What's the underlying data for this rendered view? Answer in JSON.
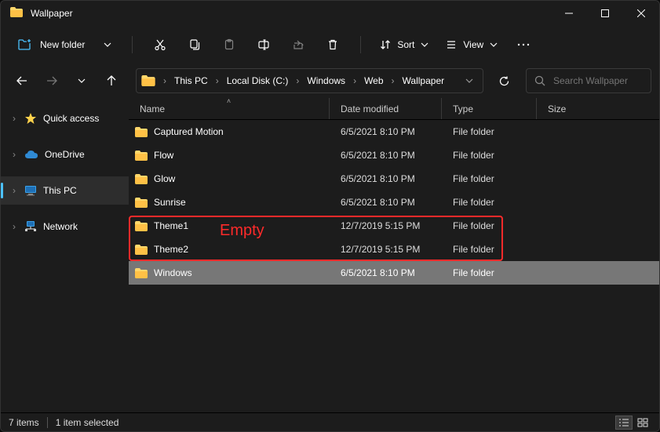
{
  "title": "Wallpaper",
  "toolbar": {
    "new_label": "New folder",
    "sort_label": "Sort",
    "view_label": "View"
  },
  "breadcrumb": [
    "This PC",
    "Local Disk (C:)",
    "Windows",
    "Web",
    "Wallpaper"
  ],
  "search": {
    "placeholder": "Search Wallpaper"
  },
  "sidebar": {
    "items": [
      {
        "label": "Quick access",
        "icon": "star"
      },
      {
        "label": "OneDrive",
        "icon": "cloud"
      },
      {
        "label": "This PC",
        "icon": "pc",
        "active": true
      },
      {
        "label": "Network",
        "icon": "network"
      }
    ]
  },
  "columns": {
    "name": "Name",
    "date": "Date modified",
    "type": "Type",
    "size": "Size"
  },
  "rows": [
    {
      "name": "Captured Motion",
      "date": "6/5/2021 8:10 PM",
      "type": "File folder"
    },
    {
      "name": "Flow",
      "date": "6/5/2021 8:10 PM",
      "type": "File folder"
    },
    {
      "name": "Glow",
      "date": "6/5/2021 8:10 PM",
      "type": "File folder"
    },
    {
      "name": "Sunrise",
      "date": "6/5/2021 8:10 PM",
      "type": "File folder"
    },
    {
      "name": "Theme1",
      "date": "12/7/2019 5:15 PM",
      "type": "File folder"
    },
    {
      "name": "Theme2",
      "date": "12/7/2019 5:15 PM",
      "type": "File folder"
    },
    {
      "name": "Windows",
      "date": "6/5/2021 8:10 PM",
      "type": "File folder",
      "selected": true
    }
  ],
  "annotation": {
    "label": "Empty"
  },
  "status": {
    "count": "7 items",
    "selected": "1 item selected"
  }
}
